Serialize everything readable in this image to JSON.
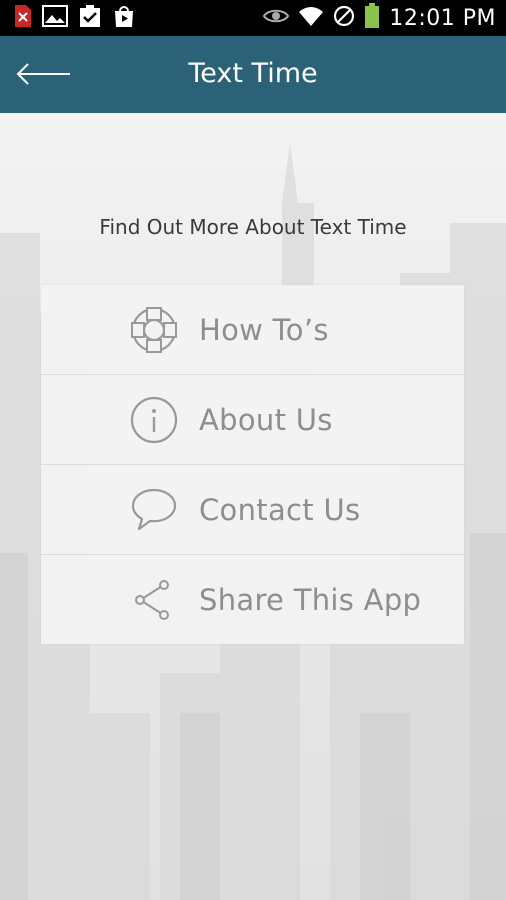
{
  "status_bar": {
    "time": "12:01 PM",
    "icons": [
      "pdf-error-icon",
      "image-icon",
      "clipboard-check-icon",
      "shopping-bag-icon",
      "eye-icon",
      "wifi-icon",
      "no-sim-icon",
      "battery-icon"
    ]
  },
  "app_bar": {
    "title": "Text Time",
    "back_icon": "arrow-left-icon"
  },
  "main": {
    "intro_text": "Find Out More About Text Time",
    "menu": [
      {
        "label": "How To’s",
        "icon": "lifebuoy-icon"
      },
      {
        "label": "About Us",
        "icon": "info-icon"
      },
      {
        "label": "Contact Us",
        "icon": "speech-bubble-icon"
      },
      {
        "label": "Share This App",
        "icon": "share-icon"
      }
    ]
  },
  "colors": {
    "app_bar": "#2b6278",
    "menu_text": "#8e8e8e",
    "intro_text": "#3a3a3a"
  }
}
